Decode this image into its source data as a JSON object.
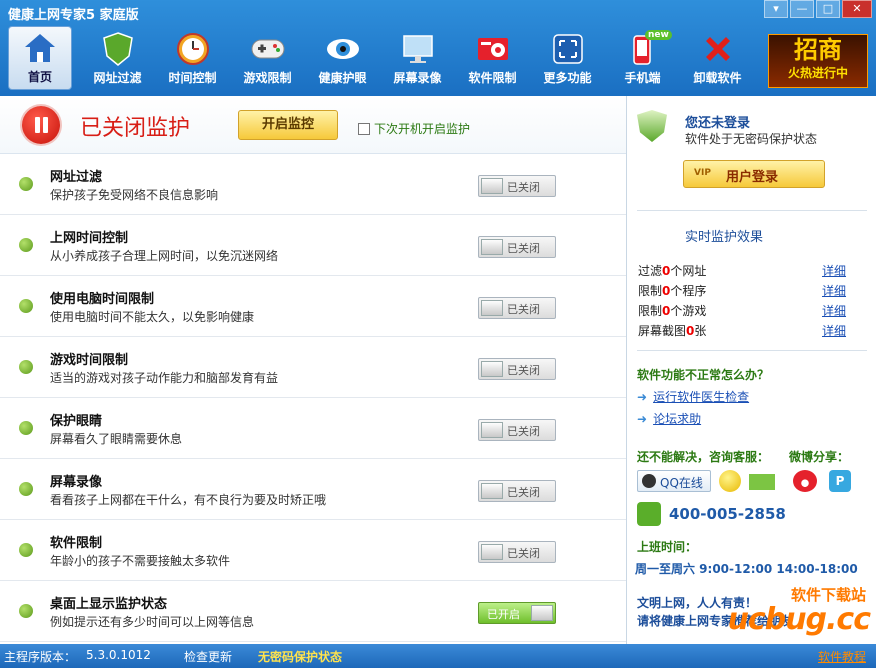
{
  "app": {
    "title": "健康上网专家5 家庭版"
  },
  "window_buttons": {
    "menu": "▾",
    "minimize": "—",
    "maximize": "□",
    "close": "✕"
  },
  "toolbar": [
    {
      "label": "首页",
      "icon": "home-icon",
      "active": true
    },
    {
      "label": "网址过滤",
      "icon": "shield-icon"
    },
    {
      "label": "时间控制",
      "icon": "clock-icon"
    },
    {
      "label": "游戏限制",
      "icon": "gamepad-icon"
    },
    {
      "label": "健康护眼",
      "icon": "eye-icon"
    },
    {
      "label": "屏幕录像",
      "icon": "monitor-icon"
    },
    {
      "label": "软件限制",
      "icon": "software-icon"
    },
    {
      "label": "更多功能",
      "icon": "more-icon"
    },
    {
      "label": "手机端",
      "icon": "phone-icon",
      "badge": "new"
    },
    {
      "label": "卸载软件",
      "icon": "uninstall-icon"
    }
  ],
  "promo": {
    "big": "招商",
    "small": "火热进行中"
  },
  "monitor": {
    "status": "已关闭监护",
    "start_label": "开启监控",
    "autostart_label": "下次开机开启监护"
  },
  "features": [
    {
      "title": "网址过滤",
      "desc": "保护孩子免受网络不良信息影响",
      "state": "已关闭",
      "on": false
    },
    {
      "title": "上网时间控制",
      "desc": "从小养成孩子合理上网时间，以免沉迷网络",
      "state": "已关闭",
      "on": false
    },
    {
      "title": "使用电脑时间限制",
      "desc": "使用电脑时间不能太久，以免影响健康",
      "state": "已关闭",
      "on": false
    },
    {
      "title": "游戏时间限制",
      "desc": "适当的游戏对孩子动作能力和脑部发育有益",
      "state": "已关闭",
      "on": false
    },
    {
      "title": "保护眼睛",
      "desc": "屏幕看久了眼睛需要休息",
      "state": "已关闭",
      "on": false
    },
    {
      "title": "屏幕录像",
      "desc": "看看孩子上网都在干什么，有不良行为要及时矫正哦",
      "state": "已关闭",
      "on": false
    },
    {
      "title": "软件限制",
      "desc": "年龄小的孩子不需要接触太多软件",
      "state": "已关闭",
      "on": false
    },
    {
      "title": "桌面上显示监护状态",
      "desc": "例如提示还有多少时间可以上网等信息",
      "state": "已开启",
      "on": true
    }
  ],
  "login": {
    "title": "您还未登录",
    "subtitle": "软件处于无密码保护状态",
    "vip": "VIP",
    "button": "用户登录"
  },
  "effect": {
    "title": "实时监护效果",
    "stats": [
      {
        "pre": "过滤",
        "n": "0",
        "post": "个网址",
        "link": "详细"
      },
      {
        "pre": "限制",
        "n": "0",
        "post": "个程序",
        "link": "详细"
      },
      {
        "pre": "限制",
        "n": "0",
        "post": "个游戏",
        "link": "详细"
      },
      {
        "pre": "屏幕截图",
        "n": "0",
        "post": "张",
        "link": "详细"
      }
    ]
  },
  "help": {
    "title": "软件功能不正常怎么办？",
    "links": [
      "运行软件医生检查",
      "论坛求助"
    ],
    "cs_title": "还不能解决，咨询客服：",
    "weibo_title": "微博分享：",
    "qq_label": "QQ在线",
    "tqq_label": "P",
    "phone": "400-005-2858",
    "work_title": "上班时间：",
    "work_hours": "周一至周六 9:00-12:00 14:00-18:00",
    "motto1": "文明上网，人人有责！",
    "motto2": "请将健康上网专家推荐给朋友"
  },
  "watermark": {
    "line1": "软件下载站",
    "line2": "ucbug.cc"
  },
  "footer": {
    "version_label": "主程序版本：",
    "version": "5.3.0.1012",
    "check_update": "检查更新",
    "no_password": "无密码保护状态",
    "tutorial": "软件教程"
  }
}
